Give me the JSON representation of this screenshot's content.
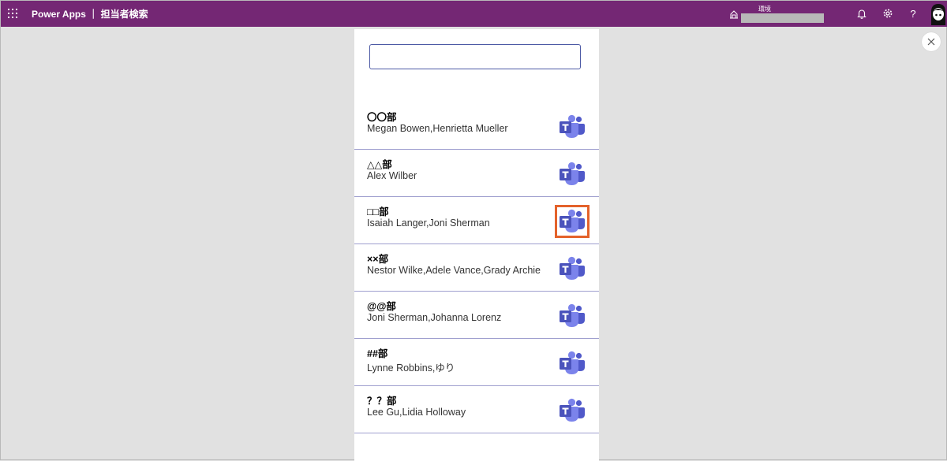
{
  "header": {
    "app_title": "Power Apps ｜ 担当者検索",
    "environment_label": "環境",
    "environment_value": "",
    "icons": [
      "waffle-icon",
      "environment-icon",
      "bell-icon",
      "gear-icon",
      "help-icon",
      "avatar"
    ]
  },
  "search": {
    "value": "",
    "placeholder": ""
  },
  "rows": [
    {
      "dept": "〇〇部",
      "members": "Megan Bowen,Henrietta Mueller"
    },
    {
      "dept": "△△部",
      "members": "Alex Wilber"
    },
    {
      "dept": "□□部",
      "members": "Isaiah Langer,Joni Sherman"
    },
    {
      "dept": "××部",
      "members": "Nestor Wilke,Adele Vance,Grady Archie"
    },
    {
      "dept": "@@部",
      "members": "Joni Sherman,Johanna Lorenz"
    },
    {
      "dept": "##部",
      "members": "Lynne Robbins,ゆり"
    },
    {
      "dept": "？？部",
      "members": "Lee Gu,Lidia Holloway"
    }
  ],
  "highlighted_row_index": 2,
  "colors": {
    "header_bg": "#742774",
    "teams_purple": "#5059c9",
    "highlight": "#e4622b",
    "divider": "#9f9fcf"
  }
}
